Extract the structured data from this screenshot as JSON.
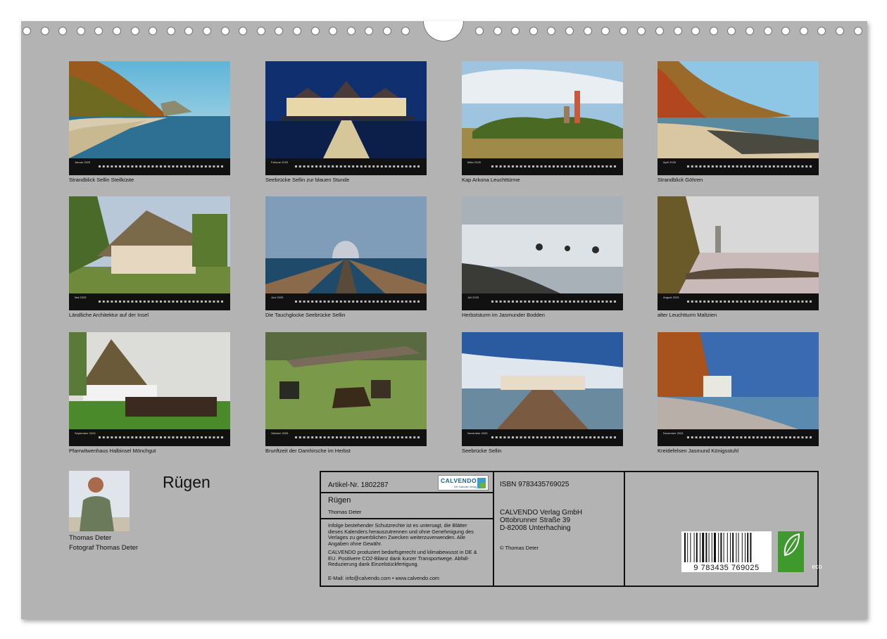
{
  "title": "Rügen",
  "months": [
    {
      "name": "Januar 2025",
      "caption": "Strandblick Sellin Steilküste"
    },
    {
      "name": "Februar 2025",
      "caption": "Seebrücke Sellin zur blauen Stunde"
    },
    {
      "name": "März 2025",
      "caption": "Kap Arkona Leuchttürme"
    },
    {
      "name": "April 2025",
      "caption": "Strandblick Göhren"
    },
    {
      "name": "Mai 2025",
      "caption": "Ländliche Architektur auf der Insel"
    },
    {
      "name": "Juni 2025",
      "caption": "Die Tauchglocke Seebrücke Sellin"
    },
    {
      "name": "Juli 2025",
      "caption": "Herbststurm im Jasmunder Bodden"
    },
    {
      "name": "August 2025",
      "caption": "alter Leuchtturm Maltzien"
    },
    {
      "name": "September 2025",
      "caption": "Pfarrwitwenhaus Halbinsel Mönchgut"
    },
    {
      "name": "Oktober 2025",
      "caption": "Brunftzeit der Damhirsche im Herbst"
    },
    {
      "name": "November 2025",
      "caption": "Seebrücke Sellin"
    },
    {
      "name": "Dezember 2025",
      "caption": "Kreidefelsen Jasmund Königsstuhl"
    }
  ],
  "author": {
    "name": "Thomas Deter",
    "role": "Fotograf Thomas Deter"
  },
  "info": {
    "article": "Artikel-Nr. 1802287",
    "logo_text": "CALVENDO",
    "logo_sub": "Der Kalender-Verlag",
    "product_title": "Rügen",
    "product_author": "Thomas Deter",
    "legal_1": "Infolge bestehender Schutzrechte ist es untersagt, die Blätter dieses Kalenders herauszutrennen und ohne Genehmigung des Verlages zu gewerblichen Zwecken weiterzuverwenden. Alle Angaben ohne Gewähr.",
    "legal_2": "CALVENDO produziert bedarfsgerecht und klimabewusst in DE & EU. Positivere CO2-Bilanz dank kurzer Transportwege. Abfall-Reduzierung dank Einzelstückfertigung.",
    "contact": "E-Mail: info@calvendo.com • www.calvendo.com",
    "isbn": "ISBN 9783435769025",
    "publisher_1": "CALVENDO Verlag GmbH",
    "publisher_2": "Ottobrunner Straße 39",
    "publisher_3": "D-82008 Unterhaching",
    "copyright": "© Thomas Deter",
    "barcode_number": "9 783435 769025",
    "eco_label": "eco"
  }
}
